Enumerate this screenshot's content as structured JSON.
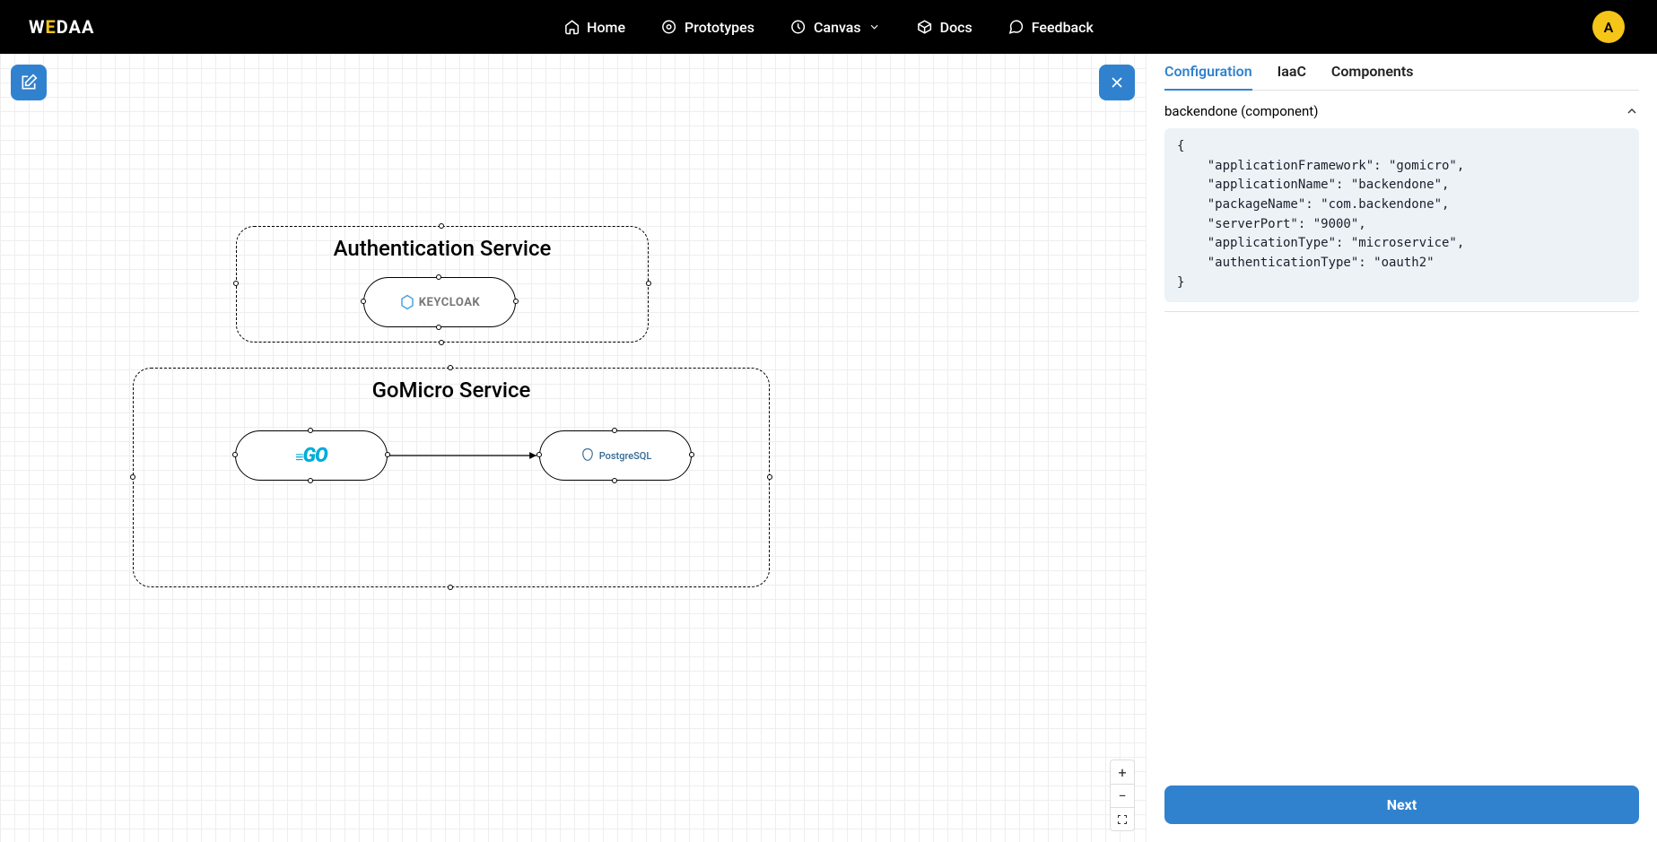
{
  "brand": "WEDAA",
  "nav": {
    "home": "Home",
    "prototypes": "Prototypes",
    "canvas": "Canvas",
    "docs": "Docs",
    "feedback": "Feedback"
  },
  "avatar": "A",
  "canvas": {
    "group1_title": "Authentication Service",
    "group2_title": "GoMicro Service",
    "node1_label": "KEYCLOAK",
    "node2_label": "GO",
    "node3_label": "PostgreSQL"
  },
  "panel": {
    "tabs": {
      "configuration": "Configuration",
      "iaac": "IaaC",
      "components": "Components"
    },
    "accordion_title": "backendone (component)",
    "config": {
      "applicationFramework": "gomicro",
      "applicationName": "backendone",
      "packageName": "com.backendone",
      "serverPort": "9000",
      "applicationType": "microservice",
      "authenticationType": "oauth2"
    },
    "next": "Next"
  }
}
